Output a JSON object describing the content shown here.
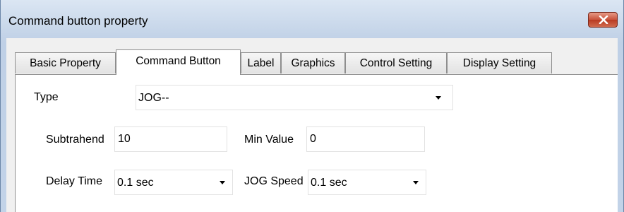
{
  "window": {
    "title": "Command button property"
  },
  "tabs": [
    {
      "label": "Basic Property",
      "active": false
    },
    {
      "label": "Command Button",
      "active": true
    },
    {
      "label": "Label",
      "active": false
    },
    {
      "label": "Graphics",
      "active": false
    },
    {
      "label": "Control Setting",
      "active": false
    },
    {
      "label": "Display Setting",
      "active": false
    }
  ],
  "form": {
    "type_label": "Type",
    "type_value": "JOG--",
    "subtrahend_label": "Subtrahend",
    "subtrahend_value": "10",
    "min_value_label": "Min Value",
    "min_value_value": "0",
    "delay_time_label": "Delay Time",
    "delay_time_value": "0.1 sec",
    "jog_speed_label": "JOG Speed",
    "jog_speed_value": "0.1 sec"
  },
  "icons": {
    "close": "close-icon",
    "dropdown": "chevron-down-icon"
  },
  "colors": {
    "close_button": "#c8513a",
    "title_bar": "#c8d7ea",
    "dialog_background": "#f0f0f0"
  }
}
